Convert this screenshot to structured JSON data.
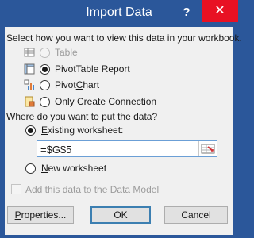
{
  "window": {
    "title": "Import Data",
    "help_glyph": "?",
    "close_glyph": "✕"
  },
  "view_section": {
    "prompt": "Select how you want to view this data in your workbook.",
    "options": [
      {
        "label": "Table",
        "icon": "table-icon",
        "selected": false,
        "enabled": false
      },
      {
        "label": "PivotTable Report",
        "icon": "pivottable-icon",
        "selected": true,
        "enabled": true
      },
      {
        "label": "PivotChart",
        "icon": "pivotchart-icon",
        "selected": false,
        "enabled": true
      },
      {
        "label": "Only Create Connection",
        "icon": "connection-icon",
        "selected": false,
        "enabled": true
      }
    ]
  },
  "destination_section": {
    "prompt": "Where do you want to put the data?",
    "existing_label": "Existing worksheet:",
    "existing_selected": true,
    "range_value": "=$G$5",
    "new_label": "New worksheet",
    "new_selected": false
  },
  "data_model": {
    "label": "Add this data to the Data Model",
    "checked": false,
    "enabled": false
  },
  "buttons": {
    "properties": "Properties...",
    "ok": "OK",
    "cancel": "Cancel"
  },
  "colors": {
    "title_bar": "#2b579a",
    "close_hover": "#e81123",
    "dialog_bg": "#f0f0f0"
  }
}
